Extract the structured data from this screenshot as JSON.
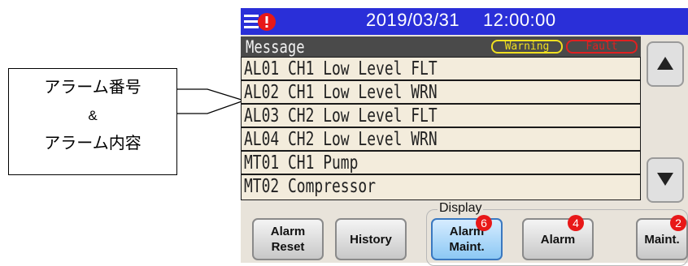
{
  "annotation": {
    "lines": [
      "アラーム番号",
      "&",
      "アラーム内容"
    ]
  },
  "header": {
    "date": "2019/03/31",
    "time": "12:00:00",
    "menu_icon": "menu-alert-icon",
    "bar_color": "#2a2fd8"
  },
  "messages": {
    "title": "Message",
    "badges": {
      "warning": "Warning",
      "fault": "Fault"
    },
    "rows": [
      "AL01 CH1 Low Level FLT",
      "AL02 CH1 Low Level WRN",
      "AL03 CH2 Low Level FLT",
      "AL04 CH2 Low Level WRN",
      "MT01 CH1 Pump",
      "MT02 Compressor"
    ]
  },
  "scroll": {
    "up_icon": "triangle-up-icon",
    "down_icon": "triangle-down-icon"
  },
  "display": {
    "label": "Display"
  },
  "buttons": {
    "alarm_reset": [
      "Alarm",
      "Reset"
    ],
    "history": "History",
    "alarm_maint": [
      "Alarm",
      "Maint."
    ],
    "alarm_maint_count": "6",
    "alarm": "Alarm",
    "alarm_count": "4",
    "maint": "Maint.",
    "maint_count": "2"
  },
  "colors": {
    "warning": "#f0e020",
    "fault": "#e02020",
    "badge": "#e81818"
  }
}
